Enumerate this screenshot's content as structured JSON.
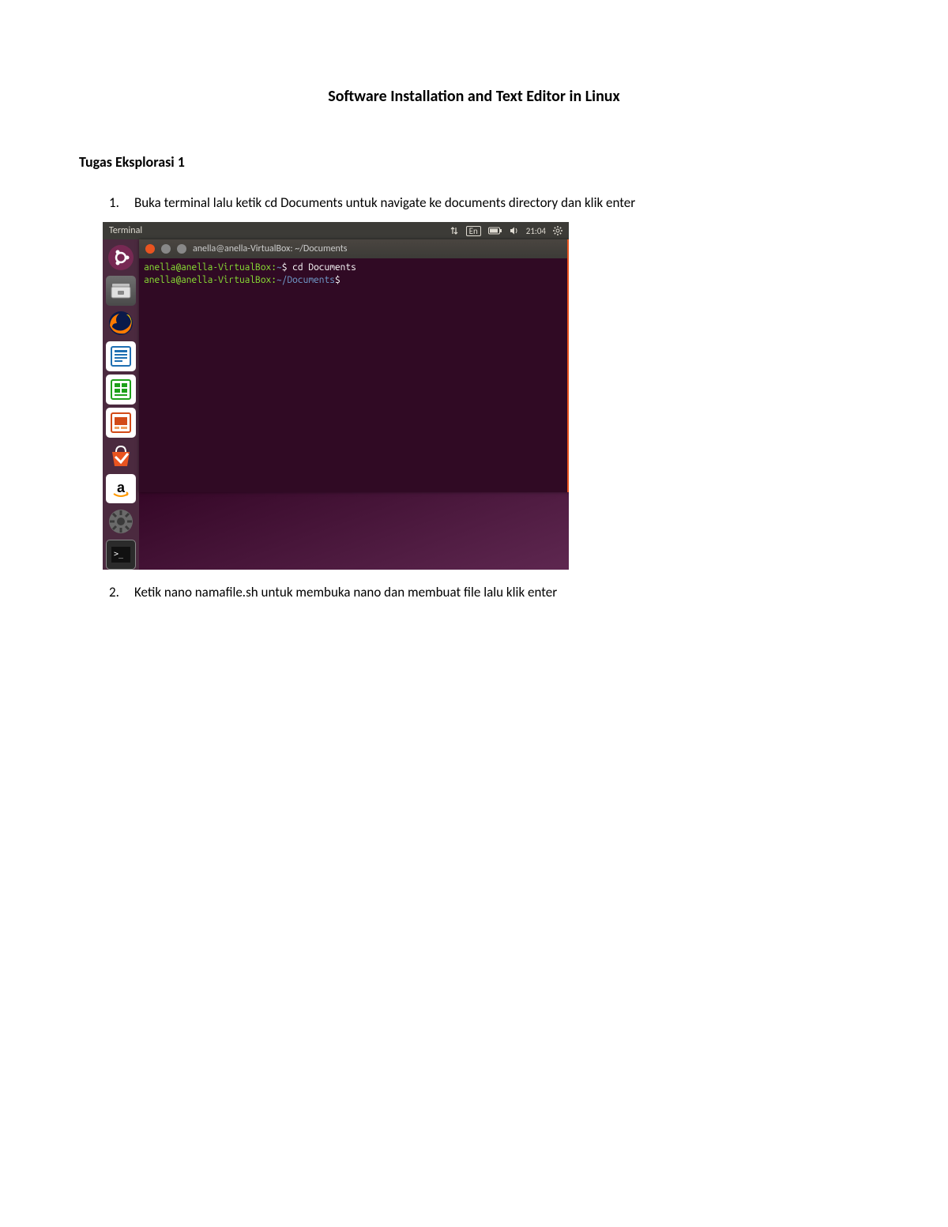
{
  "document": {
    "title": "Software Installation and Text Editor in Linux",
    "section_heading": "Tugas Eksplorasi 1",
    "steps": [
      {
        "num": "1.",
        "text": "Buka terminal lalu ketik cd Documents untuk navigate ke documents directory dan klik enter"
      },
      {
        "num": "2.",
        "text": "Ketik nano namafile.sh untuk membuka nano dan membuat file lalu klik enter"
      }
    ]
  },
  "screenshot": {
    "menubar": {
      "app_label": "Terminal",
      "indicators": {
        "lang_label": "En",
        "time": "21:04"
      }
    },
    "launcher_items": [
      {
        "name": "ubuntu-dash-icon"
      },
      {
        "name": "files-icon"
      },
      {
        "name": "firefox-icon"
      },
      {
        "name": "writer-icon"
      },
      {
        "name": "calc-icon"
      },
      {
        "name": "impress-icon"
      },
      {
        "name": "software-center-icon"
      },
      {
        "name": "amazon-icon"
      },
      {
        "name": "settings-icon"
      },
      {
        "name": "terminal-launcher-icon"
      }
    ],
    "terminal": {
      "title": "anella@anella-VirtualBox: ~/Documents",
      "lines": [
        {
          "user": "anella@anella-VirtualBox",
          "path": "~",
          "cmd": "cd Documents"
        },
        {
          "user": "anella@anella-VirtualBox",
          "path": "~/Documents",
          "cmd": ""
        }
      ]
    }
  }
}
